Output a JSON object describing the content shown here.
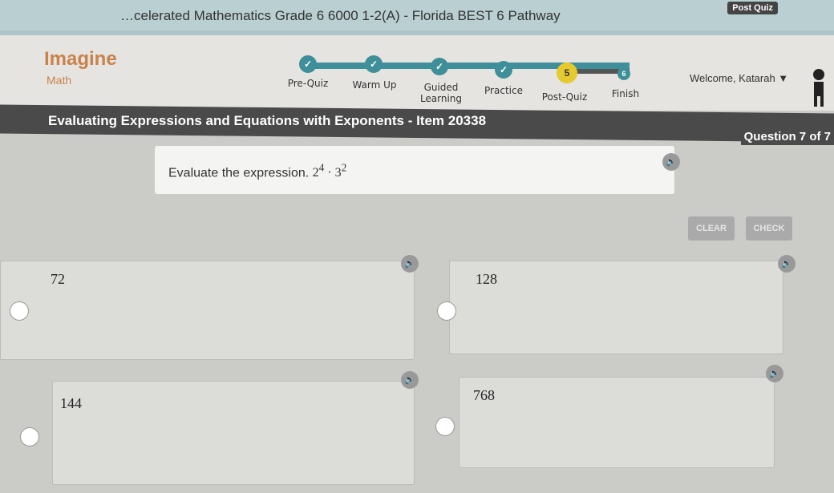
{
  "topbar": {
    "course_title": "…celerated Mathematics Grade 6 6000 1-2(A) - Florida BEST 6 Pathway",
    "post_quiz": "Post Quiz"
  },
  "brand": {
    "name": "Imagine",
    "sub": "Math"
  },
  "progress": {
    "steps": [
      {
        "label": "Pre-Quiz",
        "status": "complete"
      },
      {
        "label": "Warm Up",
        "status": "complete"
      },
      {
        "label": "Guided Learning",
        "status": "complete"
      },
      {
        "label": "Practice",
        "status": "complete"
      },
      {
        "label": "Post-Quiz",
        "status": "current",
        "number": "5"
      },
      {
        "label": "Finish",
        "status": "upcoming",
        "number": "6"
      }
    ]
  },
  "user": {
    "welcome": "Welcome, Katarah ▼"
  },
  "banner": {
    "title": "Evaluating Expressions and Equations with Exponents - Item 20338",
    "question": "Question 7 of 7"
  },
  "question": {
    "prompt": "Evaluate the expression.",
    "base1": "2",
    "exp1": "4",
    "dot": "·",
    "base2": "3",
    "exp2": "2"
  },
  "buttons": {
    "clear": "CLEAR",
    "check": "CHECK"
  },
  "answers": [
    "72",
    "128",
    "144",
    "768"
  ],
  "colors": {
    "accent": "#3e8f99",
    "current_step": "#e6c92e",
    "brand": "#c9824a"
  }
}
